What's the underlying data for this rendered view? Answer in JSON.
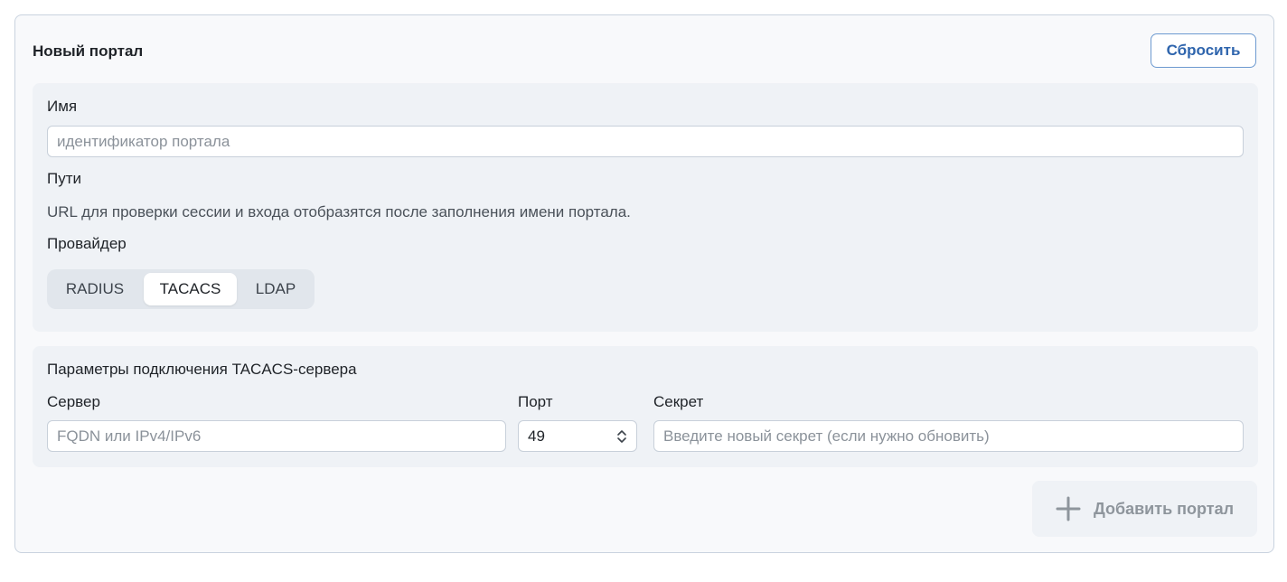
{
  "header": {
    "title": "Новый портал",
    "reset_label": "Сбросить"
  },
  "general": {
    "name_label": "Имя",
    "name_placeholder": "идентификатор портала",
    "name_value": "",
    "paths_label": "Пути",
    "paths_hint": "URL для проверки сессии и входа отобразятся после заполнения имени портала.",
    "provider_label": "Провайдер",
    "providers": [
      {
        "label": "RADIUS",
        "active": false
      },
      {
        "label": "TACACS",
        "active": true
      },
      {
        "label": "LDAP",
        "active": false
      }
    ]
  },
  "connection": {
    "title": "Параметры подключения TACACS-сервера",
    "server_label": "Сервер",
    "server_placeholder": "FQDN или IPv4/IPv6",
    "server_value": "",
    "port_label": "Порт",
    "port_value": "49",
    "secret_label": "Секрет",
    "secret_placeholder": "Введите новый секрет (если нужно обновить)",
    "secret_value": ""
  },
  "footer": {
    "add_label": "Добавить портал",
    "add_icon": "plus-icon",
    "add_disabled": true
  }
}
